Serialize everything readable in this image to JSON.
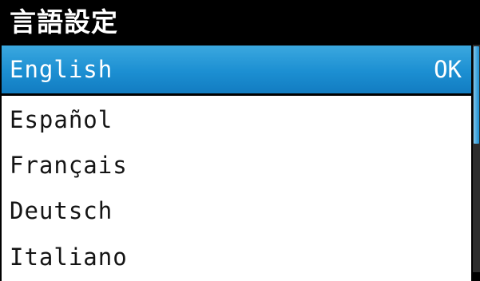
{
  "screen": {
    "title": "言語設定"
  },
  "language_list": {
    "items": [
      {
        "label": "English",
        "status": "OK",
        "selected": true
      },
      {
        "label": "Español",
        "status": "",
        "selected": false
      },
      {
        "label": "Français",
        "status": "",
        "selected": false
      },
      {
        "label": "Deutsch",
        "status": "",
        "selected": false
      },
      {
        "label": "Italiano",
        "status": "",
        "selected": false
      }
    ]
  },
  "scrollbar": {
    "visible_fraction": 0.45,
    "position": 0
  },
  "colors": {
    "background": "#000000",
    "title_text": "#ffffff",
    "selected_row": "#1c8fd2",
    "row_background": "#ffffff",
    "row_text": "#141414"
  }
}
